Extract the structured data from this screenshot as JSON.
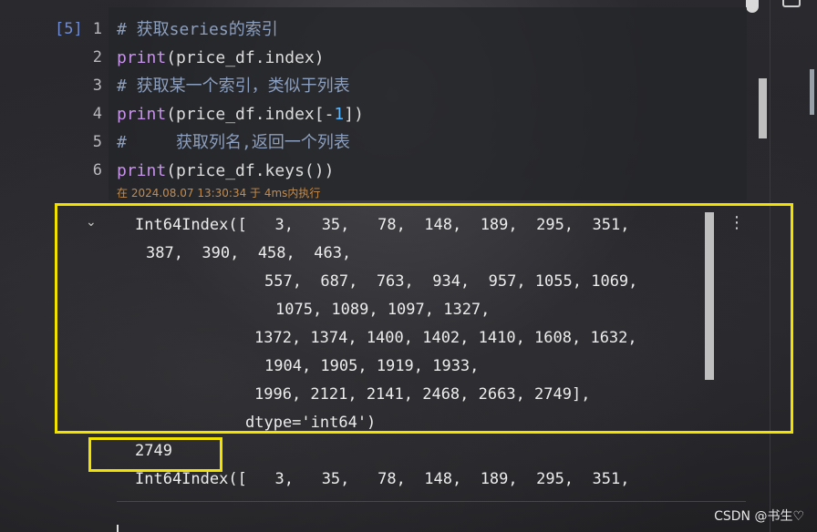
{
  "cell": {
    "exec_count": "[5]",
    "line_numbers": [
      "1",
      "2",
      "3",
      "4",
      "5",
      "6"
    ],
    "code": [
      {
        "parts": [
          {
            "t": "# 获取series的索引",
            "c": "cm"
          }
        ]
      },
      {
        "parts": [
          {
            "t": "print",
            "c": "kw"
          },
          {
            "t": "(price_df.index)",
            "c": ""
          }
        ]
      },
      {
        "parts": [
          {
            "t": "# 获取某一个索引，类似于列表",
            "c": "cm"
          }
        ]
      },
      {
        "parts": [
          {
            "t": "print",
            "c": "kw"
          },
          {
            "t": "(price_df.index[-",
            "c": ""
          },
          {
            "t": "1",
            "c": "num"
          },
          {
            "t": "])",
            "c": ""
          }
        ]
      },
      {
        "parts": [
          {
            "t": "#     获取列名,返回一个列表",
            "c": "cm"
          }
        ]
      },
      {
        "parts": [
          {
            "t": "print",
            "c": "kw"
          },
          {
            "t": "(price_df.keys())",
            "c": ""
          }
        ]
      }
    ],
    "timestamp": "在 2024.08.07 13:30:34 于 4ms内执行"
  },
  "output": {
    "lines": [
      "Int64Index([   3,   35,   78,  148,  189,  295,  351,",
      "387,  390,  458,  463,",
      "557,  687,  763,  934,  957, 1055, 1069,",
      "1075, 1089, 1097, 1327,",
      "1372, 1374, 1400, 1402, 1410, 1608, 1632,",
      "1904, 1905, 1919, 1933,",
      "1996, 2121, 2141, 2468, 2663, 2749],",
      "dtype='int64')"
    ],
    "last_index": "2749",
    "keys_line": "Int64Index([   3,   35,   78,  148,  189,  295,  351,"
  },
  "toolbar": {
    "collapse_icon": "chevron-down-icon",
    "more_icon": "more-vertical-icon",
    "more_glyph": "⋮",
    "collapse_glyph": "⌄"
  },
  "watermark": "CSDN @书生♡",
  "colors": {
    "highlight": "#f2e200",
    "comment": "#8c9fbf",
    "keyword": "#c792ea",
    "number": "#56b6ff",
    "timestamp": "#c58b4a"
  }
}
